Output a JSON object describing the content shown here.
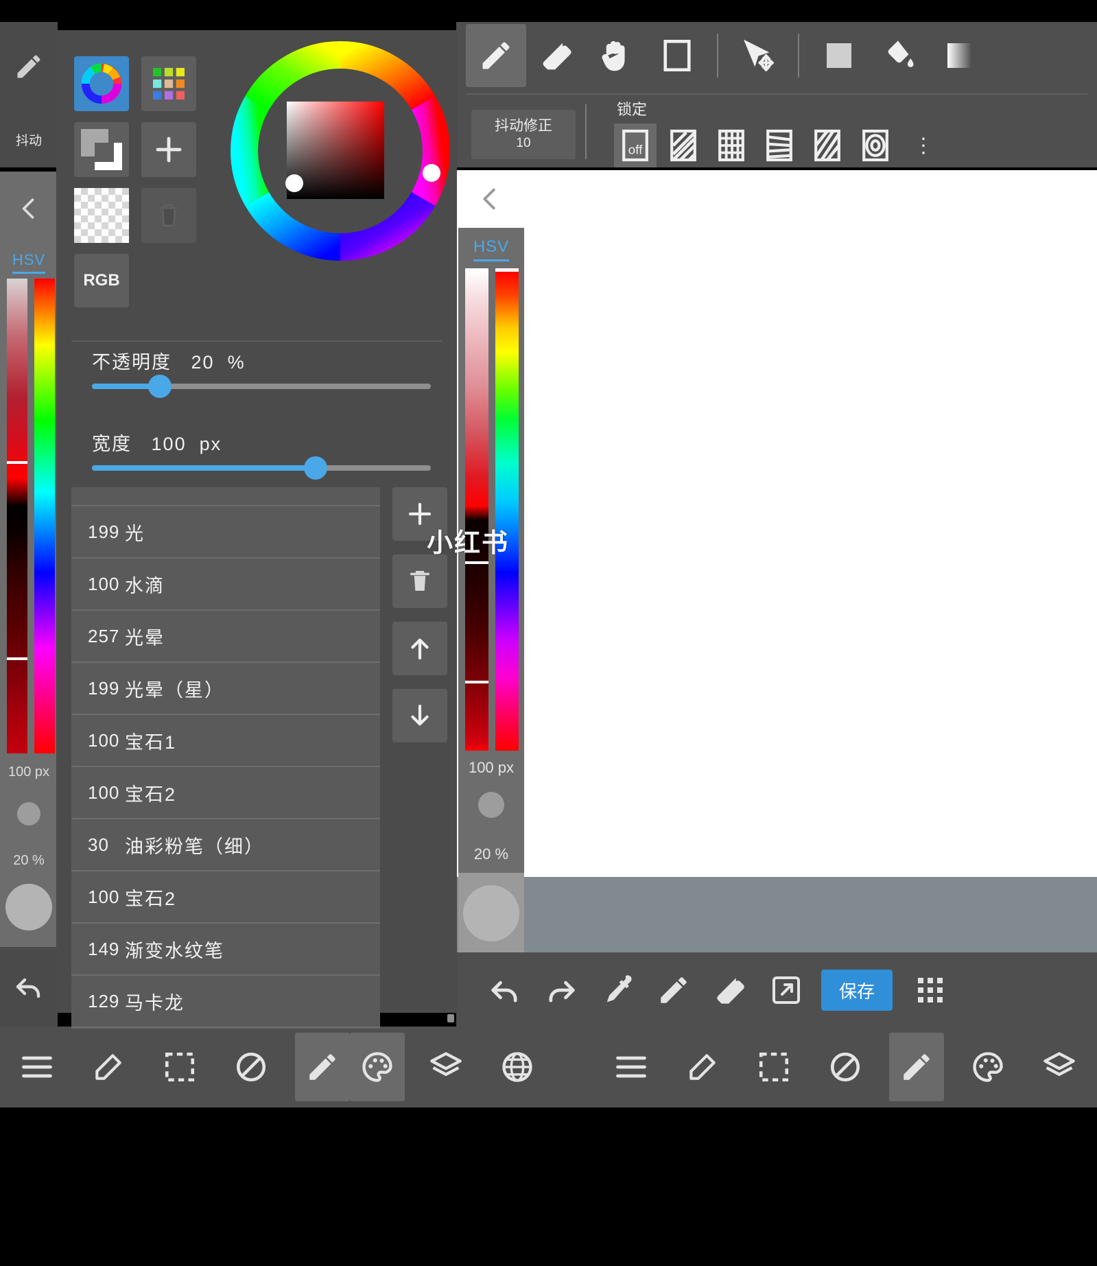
{
  "app": {
    "accent_blue": "#4aa8e8",
    "panel_bg": "#4b4b4b",
    "toolbar_bg": "#4f4f4f",
    "save_button_color": "#2f8fd8"
  },
  "top_toolbar": {
    "tools": [
      {
        "name": "pencil-tool",
        "icon": "pencil-icon",
        "selected": true
      },
      {
        "name": "eraser-tool",
        "icon": "eraser-icon",
        "selected": false
      },
      {
        "name": "hand-tool",
        "icon": "hand-icon",
        "selected": false
      },
      {
        "name": "canvas-tool",
        "icon": "rectangle-icon",
        "selected": false
      },
      {
        "name": "select-move-tool",
        "icon": "cursor-move-icon",
        "selected": false
      },
      {
        "name": "fill-shape-tool",
        "icon": "filled-square-icon",
        "selected": false
      },
      {
        "name": "bucket-tool",
        "icon": "paint-bucket-icon",
        "selected": false
      },
      {
        "name": "gradient-tool",
        "icon": "gradient-icon",
        "selected": false
      }
    ],
    "jitter": {
      "label": "抖动修正",
      "value": "10"
    },
    "lock": {
      "label": "锁定",
      "options": [
        {
          "name": "lock-off",
          "label": "off",
          "selected": true
        },
        {
          "name": "lock-diagonal",
          "label": "",
          "selected": false
        },
        {
          "name": "lock-grid",
          "label": "",
          "selected": false
        },
        {
          "name": "lock-horizontal",
          "label": "",
          "selected": false
        },
        {
          "name": "lock-perspective",
          "label": "",
          "selected": false
        },
        {
          "name": "lock-radial",
          "label": "",
          "selected": false
        }
      ],
      "more": "⋮"
    }
  },
  "color_panel": {
    "mode_buttons": [
      {
        "name": "color-wheel-mode",
        "icon": "color-wheel-icon",
        "selected": true
      },
      {
        "name": "palette-mode",
        "icon": "palette-grid-icon",
        "selected": false
      },
      {
        "name": "fg-bg-swap",
        "icon": "foreground-background-icon",
        "selected": false
      },
      {
        "name": "add-color",
        "icon": "plus-icon",
        "selected": false
      },
      {
        "name": "transparent-swatch",
        "icon": "checkerboard-icon",
        "selected": false
      },
      {
        "name": "delete-color",
        "icon": "trash-icon",
        "selected": false
      }
    ],
    "rgb_button": "RGB",
    "opacity": {
      "label": "不透明度",
      "value": "20",
      "unit": "%",
      "percent": 20
    },
    "width": {
      "label": "宽度",
      "value": "100",
      "unit": "px",
      "percent": 66
    }
  },
  "brush_list": {
    "items": [
      {
        "num": "199",
        "name": "光"
      },
      {
        "num": "100",
        "name": "水滴"
      },
      {
        "num": "257",
        "name": "光晕"
      },
      {
        "num": "199",
        "name": "光晕（星）"
      },
      {
        "num": "100",
        "name": "宝石1"
      },
      {
        "num": "100",
        "name": "宝石2"
      },
      {
        "num": "30",
        "name": "油彩粉笔（细）"
      },
      {
        "num": "100",
        "name": "宝石2"
      },
      {
        "num": "149",
        "name": "渐变水纹笔"
      },
      {
        "num": "129",
        "name": "马卡龙"
      }
    ],
    "side_buttons": [
      {
        "name": "add-brush-button",
        "glyph": "＋"
      },
      {
        "name": "delete-brush-button",
        "glyph": "trash-icon"
      },
      {
        "name": "move-up-button",
        "glyph": "↑"
      },
      {
        "name": "move-down-button",
        "glyph": "↓"
      }
    ]
  },
  "hsv_panel": {
    "tab": "HSV",
    "width_value": "100",
    "width_unit": "px",
    "opacity_value": "20 %"
  },
  "left_bg_panel": {
    "tool_label": "抖动",
    "hsv_tab": "HSV",
    "width_value": "100 px",
    "opacity_value": "20 %"
  },
  "bottom_toolbar": {
    "buttons": [
      {
        "name": "undo-button",
        "icon": "undo-arrow-icon"
      },
      {
        "name": "redo-button",
        "icon": "redo-arrow-icon"
      },
      {
        "name": "eyedropper-button",
        "icon": "eyedropper-icon"
      },
      {
        "name": "brush-button",
        "icon": "pencil-icon"
      },
      {
        "name": "eraser-button",
        "icon": "eraser-icon"
      },
      {
        "name": "share-button",
        "icon": "external-link-icon"
      }
    ],
    "save_label": "保存",
    "grid_button": "grid-dots-icon"
  },
  "nav_bar": {
    "left_group": [
      {
        "name": "nav-menu",
        "icon": "hamburger-icon",
        "selected": false
      },
      {
        "name": "nav-edit",
        "icon": "edit-square-icon",
        "selected": false
      },
      {
        "name": "nav-select",
        "icon": "dashed-square-icon",
        "selected": false
      },
      {
        "name": "nav-transform",
        "icon": "circle-slash-icon",
        "selected": false
      },
      {
        "name": "nav-brush",
        "icon": "pencil-icon",
        "selected": true
      },
      {
        "name": "nav-palette",
        "icon": "palette-icon",
        "selected": true
      },
      {
        "name": "nav-layers",
        "icon": "layers-icon",
        "selected": false
      },
      {
        "name": "nav-globe",
        "icon": "globe-grid-icon",
        "selected": false
      }
    ],
    "right_group": [
      {
        "name": "nav-menu-2",
        "icon": "hamburger-icon",
        "selected": false
      },
      {
        "name": "nav-edit-2",
        "icon": "edit-square-icon",
        "selected": false
      },
      {
        "name": "nav-select-2",
        "icon": "dashed-square-icon",
        "selected": false
      },
      {
        "name": "nav-transform-2",
        "icon": "circle-slash-icon",
        "selected": false
      },
      {
        "name": "nav-brush-2",
        "icon": "pencil-icon",
        "selected": true
      },
      {
        "name": "nav-palette-2",
        "icon": "palette-icon",
        "selected": false
      },
      {
        "name": "nav-layers-2",
        "icon": "layers-icon",
        "selected": false
      },
      {
        "name": "nav-globe-2",
        "icon": "globe-grid-icon",
        "selected": false
      }
    ]
  },
  "watermark": {
    "text": "小红书"
  }
}
